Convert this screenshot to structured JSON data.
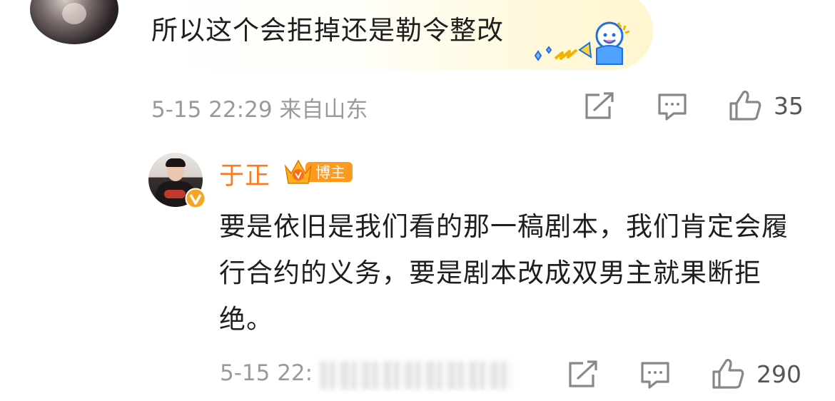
{
  "comment": {
    "text": "所以这个会拒掉还是勒令整改",
    "meta": "5-15 22:29 来自山东",
    "likes": "35"
  },
  "reply": {
    "username": "于正",
    "badge_label": "博主",
    "text": "要是依旧是我们看的那一稿剧本，我们肯定会履行合约的义务，要是剧本改成双男主就果断拒绝。",
    "meta_visible": "5-15 22:",
    "likes": "290"
  },
  "icons": {
    "share": "share-icon",
    "comment": "comment-icon",
    "like": "thumbs-up-icon",
    "verified": "verified-v-icon",
    "crown": "crown-badge-icon"
  },
  "colors": {
    "username": "#ff7a1a",
    "meta": "#9a9a9a",
    "badge": "#ff9a1f",
    "verified": "#f5a623"
  }
}
